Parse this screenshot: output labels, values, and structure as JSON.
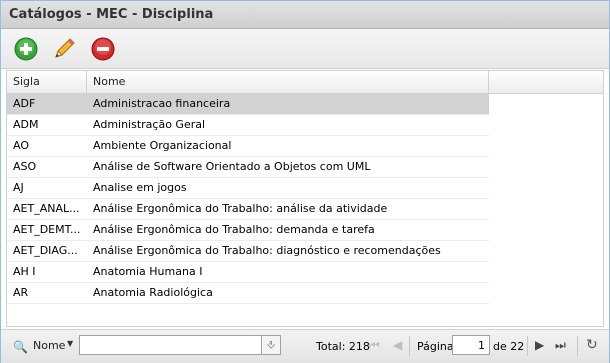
{
  "window": {
    "title": "Catálogos - MEC - Disciplina"
  },
  "toolbar": {
    "add_icon": "add-circle-icon",
    "edit_icon": "pencil-icon",
    "delete_icon": "remove-circle-icon"
  },
  "grid": {
    "columns": [
      "Sigla",
      "Nome"
    ],
    "rows": [
      {
        "sigla": "ADF",
        "nome": "Administracao financeira"
      },
      {
        "sigla": "ADM",
        "nome": "Administração Geral"
      },
      {
        "sigla": "AO",
        "nome": "Ambiente Organizacional"
      },
      {
        "sigla": "ASO",
        "nome": "Análise de Software Orientado a Objetos com UML"
      },
      {
        "sigla": "AJ",
        "nome": "Analise em jogos"
      },
      {
        "sigla": "AET_ANAL...",
        "nome": "Análise Ergonômica do Trabalho: análise da atividade"
      },
      {
        "sigla": "AET_DEMT...",
        "nome": "Análise Ergonômica do Trabalho: demanda e tarefa"
      },
      {
        "sigla": "AET_DIAG...",
        "nome": "Análise Ergonômica do Trabalho: diagnóstico e recomendações"
      },
      {
        "sigla": "AH I",
        "nome": "Anatomia Humana I"
      },
      {
        "sigla": "AR",
        "nome": "Anatomia Radiológica"
      }
    ],
    "selected_index": 0
  },
  "pager": {
    "search_field": "Nome",
    "search_value": "",
    "total_text": "Total: 218",
    "page_label": "Página",
    "current_page": "1",
    "of_text": "de 22"
  },
  "colors": {
    "selected_row": "#d2d2d2",
    "add": "#3aa23a",
    "delete": "#d12a2a",
    "pencil": "#e8a317"
  }
}
